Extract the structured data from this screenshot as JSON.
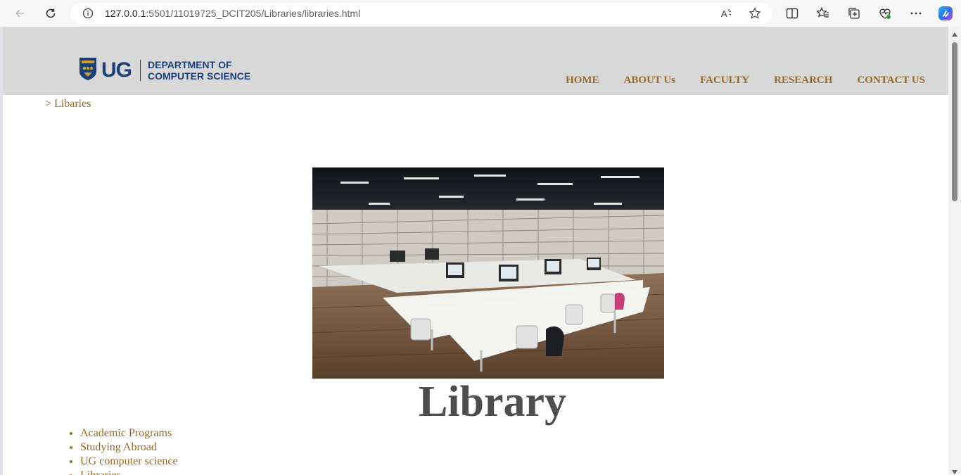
{
  "browser": {
    "url_host": "127.0.0.1",
    "url_rest": ":5501/11019725_DCIT205/Libraries/libraries.html"
  },
  "header": {
    "logo_ug": "UG",
    "logo_dept_line1": "DEPARTMENT OF",
    "logo_dept_line2": "COMPUTER SCIENCE",
    "nav": [
      "HOME",
      "ABOUT Us",
      "FACULTY",
      "RESEARCH",
      "CONTACT US"
    ]
  },
  "breadcrumb": "> Libaries",
  "main": {
    "heading": "Library",
    "links": [
      "Academic Programs",
      "Studying Abroad",
      "UG computer science",
      "Libraries"
    ]
  },
  "colors": {
    "nav_text": "#9a6a22",
    "header_bg": "#d8d8d8",
    "brand_blue": "#1d3f78"
  }
}
